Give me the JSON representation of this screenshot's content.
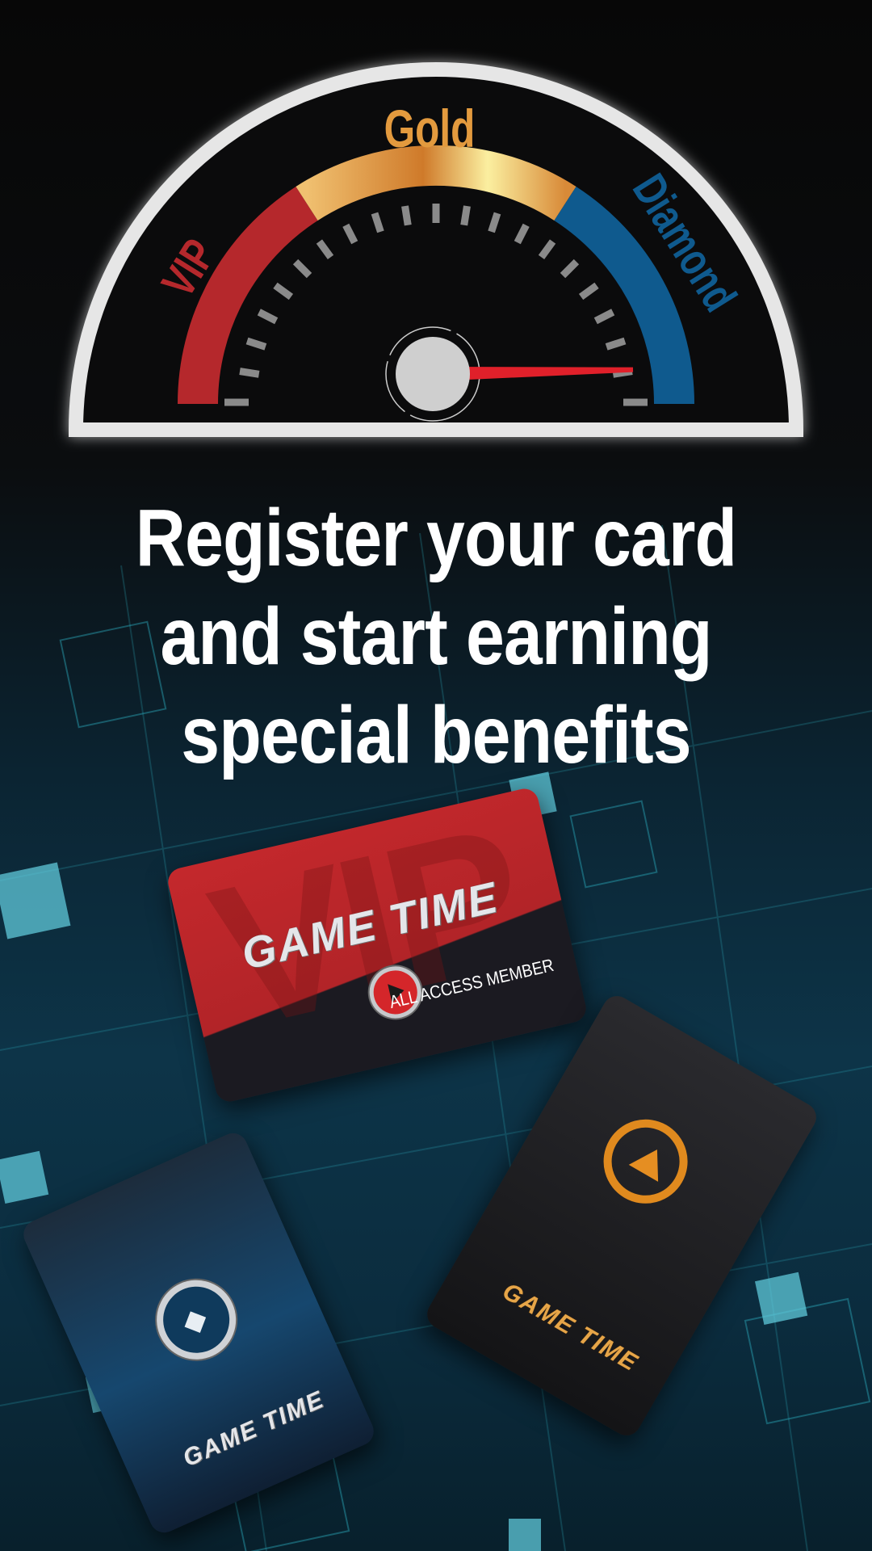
{
  "gauge": {
    "labels": {
      "vip": "VIP",
      "gold": "Gold",
      "diamond": "Diamond"
    },
    "colors": {
      "vip": "#b5282c",
      "gold": "#e8a04a",
      "diamond": "#0f5a8e",
      "needle": "#e0202a"
    },
    "needle_level": 0.96
  },
  "headline": {
    "line1": "Register your card",
    "line2": "and start earning",
    "line3": "special benefits"
  },
  "cards": {
    "vip": {
      "watermark": "VIP",
      "brand": "GAME TIME",
      "tagline": "ALL ACCESS MEMBER"
    },
    "diamond": {
      "brand": "GAME TIME"
    },
    "black": {
      "brand": "GAME TIME"
    }
  }
}
